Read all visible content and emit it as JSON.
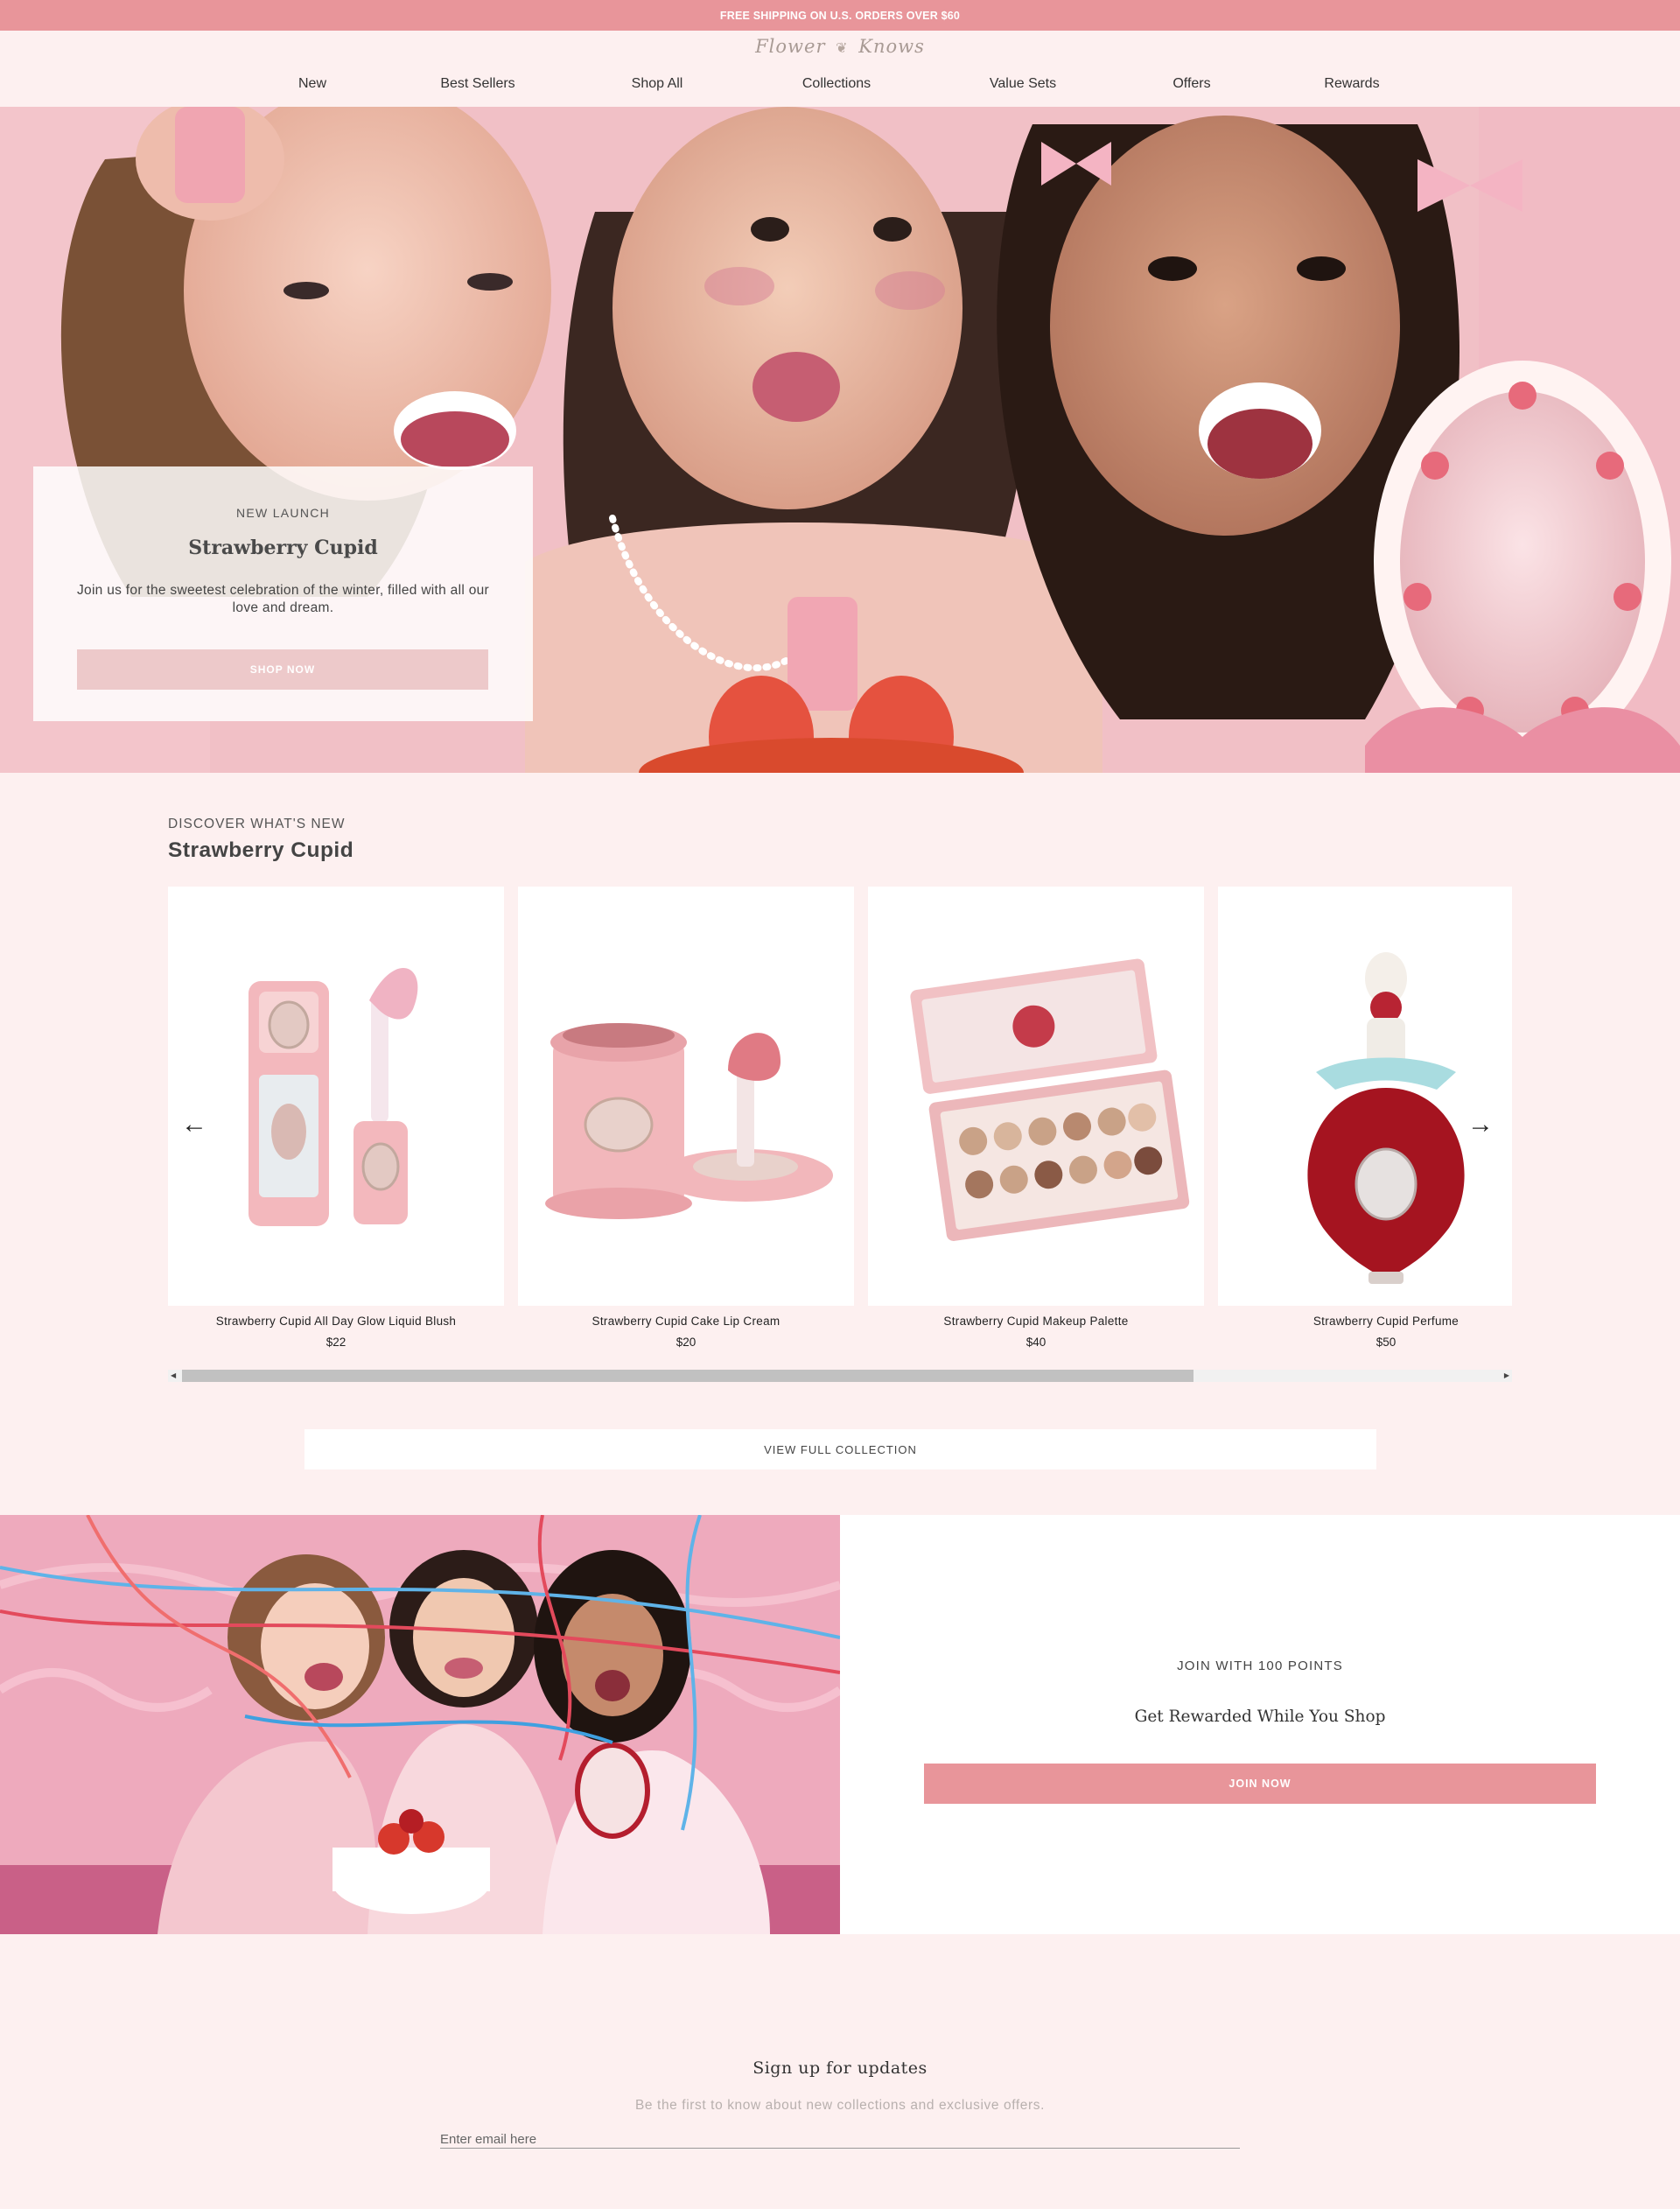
{
  "announcement": "FREE SHIPPING ON U.S. ORDERS OVER $60",
  "header": {
    "logo_left": "Flower",
    "logo_right": "Knows",
    "nav": [
      "New",
      "Best Sellers",
      "Shop All",
      "Collections",
      "Value Sets",
      "Offers",
      "Rewards"
    ]
  },
  "hero": {
    "eyebrow": "NEW LAUNCH",
    "title": "Strawberry Cupid",
    "description": "Join us for the sweetest celebration of the winter, filled with all our love and dream.",
    "cta": "SHOP NOW"
  },
  "discover": {
    "eyebrow": "DISCOVER WHAT'S NEW",
    "title": "Strawberry Cupid",
    "prev_icon": "arrow-left-icon",
    "next_icon": "arrow-right-icon",
    "products": [
      {
        "name": "Strawberry Cupid All Day Glow Liquid Blush",
        "price": "$22"
      },
      {
        "name": "Strawberry Cupid Cake Lip Cream",
        "price": "$20"
      },
      {
        "name": "Strawberry Cupid Makeup Palette",
        "price": "$40"
      },
      {
        "name": "Strawberry Cupid Perfume",
        "price": "$50"
      }
    ],
    "view_all": "VIEW FULL COLLECTION"
  },
  "rewards": {
    "eyebrow": "JOIN WITH 100 POINTS",
    "title": "Get Rewarded While You Shop",
    "cta": "JOIN NOW"
  },
  "newsletter": {
    "title": "Sign up for updates",
    "subtitle": "Be the first to know about new collections and exclusive offers.",
    "placeholder": "Enter email here"
  },
  "colors": {
    "accent": "#e8959a",
    "background": "#fdf0f0",
    "hero_button": "#edc9ca"
  }
}
